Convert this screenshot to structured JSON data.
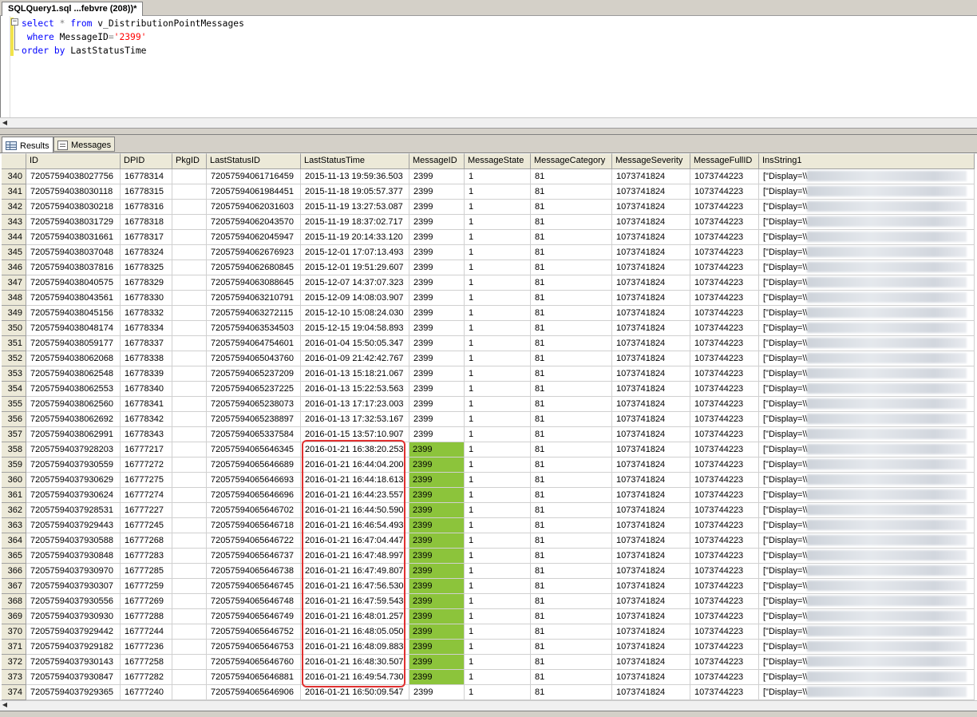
{
  "doc_tab": {
    "label": "SQLQuery1.sql ...febvre (208))*"
  },
  "query": {
    "line1": {
      "kw_select": "select",
      "star": " * ",
      "kw_from": "from",
      "table": " v_DistributionPointMessages"
    },
    "line2": {
      "kw_where": "where",
      "col": " MessageID",
      "op": "=",
      "value": "'2399'"
    },
    "line3": {
      "kw_order": "order",
      "kw_by": " by",
      "col": " LastStatusTime"
    }
  },
  "result_tabs": {
    "results": "Results",
    "messages": "Messages"
  },
  "columns": [
    "",
    "ID",
    "DPID",
    "PkgID",
    "LastStatusID",
    "LastStatusTime",
    "MessageID",
    "MessageState",
    "MessageCategory",
    "MessageSeverity",
    "MessageFullID",
    "InsString1"
  ],
  "rows": [
    [
      "340",
      "72057594038027756",
      "16778314",
      "",
      "72057594061716459",
      "2015-11-13 19:59:36.503",
      "2399",
      "1",
      "81",
      "1073741824",
      "1073744223",
      "[\"Display=\\\\"
    ],
    [
      "341",
      "72057594038030118",
      "16778315",
      "",
      "72057594061984451",
      "2015-11-18 19:05:57.377",
      "2399",
      "1",
      "81",
      "1073741824",
      "1073744223",
      "[\"Display=\\\\"
    ],
    [
      "342",
      "72057594038030218",
      "16778316",
      "",
      "72057594062031603",
      "2015-11-19 13:27:53.087",
      "2399",
      "1",
      "81",
      "1073741824",
      "1073744223",
      "[\"Display=\\\\"
    ],
    [
      "343",
      "72057594038031729",
      "16778318",
      "",
      "72057594062043570",
      "2015-11-19 18:37:02.717",
      "2399",
      "1",
      "81",
      "1073741824",
      "1073744223",
      "[\"Display=\\\\"
    ],
    [
      "344",
      "72057594038031661",
      "16778317",
      "",
      "72057594062045947",
      "2015-11-19 20:14:33.120",
      "2399",
      "1",
      "81",
      "1073741824",
      "1073744223",
      "[\"Display=\\\\"
    ],
    [
      "345",
      "72057594038037048",
      "16778324",
      "",
      "72057594062676923",
      "2015-12-01 17:07:13.493",
      "2399",
      "1",
      "81",
      "1073741824",
      "1073744223",
      "[\"Display=\\\\"
    ],
    [
      "346",
      "72057594038037816",
      "16778325",
      "",
      "72057594062680845",
      "2015-12-01 19:51:29.607",
      "2399",
      "1",
      "81",
      "1073741824",
      "1073744223",
      "[\"Display=\\\\"
    ],
    [
      "347",
      "72057594038040575",
      "16778329",
      "",
      "72057594063088645",
      "2015-12-07 14:37:07.323",
      "2399",
      "1",
      "81",
      "1073741824",
      "1073744223",
      "[\"Display=\\\\"
    ],
    [
      "348",
      "72057594038043561",
      "16778330",
      "",
      "72057594063210791",
      "2015-12-09 14:08:03.907",
      "2399",
      "1",
      "81",
      "1073741824",
      "1073744223",
      "[\"Display=\\\\"
    ],
    [
      "349",
      "72057594038045156",
      "16778332",
      "",
      "72057594063272115",
      "2015-12-10 15:08:24.030",
      "2399",
      "1",
      "81",
      "1073741824",
      "1073744223",
      "[\"Display=\\\\"
    ],
    [
      "350",
      "72057594038048174",
      "16778334",
      "",
      "72057594063534503",
      "2015-12-15 19:04:58.893",
      "2399",
      "1",
      "81",
      "1073741824",
      "1073744223",
      "[\"Display=\\\\"
    ],
    [
      "351",
      "72057594038059177",
      "16778337",
      "",
      "72057594064754601",
      "2016-01-04 15:50:05.347",
      "2399",
      "1",
      "81",
      "1073741824",
      "1073744223",
      "[\"Display=\\\\"
    ],
    [
      "352",
      "72057594038062068",
      "16778338",
      "",
      "72057594065043760",
      "2016-01-09 21:42:42.767",
      "2399",
      "1",
      "81",
      "1073741824",
      "1073744223",
      "[\"Display=\\\\"
    ],
    [
      "353",
      "72057594038062548",
      "16778339",
      "",
      "72057594065237209",
      "2016-01-13 15:18:21.067",
      "2399",
      "1",
      "81",
      "1073741824",
      "1073744223",
      "[\"Display=\\\\"
    ],
    [
      "354",
      "72057594038062553",
      "16778340",
      "",
      "72057594065237225",
      "2016-01-13 15:22:53.563",
      "2399",
      "1",
      "81",
      "1073741824",
      "1073744223",
      "[\"Display=\\\\"
    ],
    [
      "355",
      "72057594038062560",
      "16778341",
      "",
      "72057594065238073",
      "2016-01-13 17:17:23.003",
      "2399",
      "1",
      "81",
      "1073741824",
      "1073744223",
      "[\"Display=\\\\"
    ],
    [
      "356",
      "72057594038062692",
      "16778342",
      "",
      "72057594065238897",
      "2016-01-13 17:32:53.167",
      "2399",
      "1",
      "81",
      "1073741824",
      "1073744223",
      "[\"Display=\\\\"
    ],
    [
      "357",
      "72057594038062991",
      "16778343",
      "",
      "72057594065337584",
      "2016-01-15 13:57:10.907",
      "2399",
      "1",
      "81",
      "1073741824",
      "1073744223",
      "[\"Display=\\\\"
    ],
    [
      "358",
      "72057594037928203",
      "16777217",
      "",
      "72057594065646345",
      "2016-01-21 16:38:20.253",
      "2399",
      "1",
      "81",
      "1073741824",
      "1073744223",
      "[\"Display=\\\\"
    ],
    [
      "359",
      "72057594037930559",
      "16777272",
      "",
      "72057594065646689",
      "2016-01-21 16:44:04.200",
      "2399",
      "1",
      "81",
      "1073741824",
      "1073744223",
      "[\"Display=\\\\"
    ],
    [
      "360",
      "72057594037930629",
      "16777275",
      "",
      "72057594065646693",
      "2016-01-21 16:44:18.613",
      "2399",
      "1",
      "81",
      "1073741824",
      "1073744223",
      "[\"Display=\\\\"
    ],
    [
      "361",
      "72057594037930624",
      "16777274",
      "",
      "72057594065646696",
      "2016-01-21 16:44:23.557",
      "2399",
      "1",
      "81",
      "1073741824",
      "1073744223",
      "[\"Display=\\\\"
    ],
    [
      "362",
      "72057594037928531",
      "16777227",
      "",
      "72057594065646702",
      "2016-01-21 16:44:50.590",
      "2399",
      "1",
      "81",
      "1073741824",
      "1073744223",
      "[\"Display=\\\\"
    ],
    [
      "363",
      "72057594037929443",
      "16777245",
      "",
      "72057594065646718",
      "2016-01-21 16:46:54.493",
      "2399",
      "1",
      "81",
      "1073741824",
      "1073744223",
      "[\"Display=\\\\"
    ],
    [
      "364",
      "72057594037930588",
      "16777268",
      "",
      "72057594065646722",
      "2016-01-21 16:47:04.447",
      "2399",
      "1",
      "81",
      "1073741824",
      "1073744223",
      "[\"Display=\\\\"
    ],
    [
      "365",
      "72057594037930848",
      "16777283",
      "",
      "72057594065646737",
      "2016-01-21 16:47:48.997",
      "2399",
      "1",
      "81",
      "1073741824",
      "1073744223",
      "[\"Display=\\\\"
    ],
    [
      "366",
      "72057594037930970",
      "16777285",
      "",
      "72057594065646738",
      "2016-01-21 16:47:49.807",
      "2399",
      "1",
      "81",
      "1073741824",
      "1073744223",
      "[\"Display=\\\\"
    ],
    [
      "367",
      "72057594037930307",
      "16777259",
      "",
      "72057594065646745",
      "2016-01-21 16:47:56.530",
      "2399",
      "1",
      "81",
      "1073741824",
      "1073744223",
      "[\"Display=\\\\"
    ],
    [
      "368",
      "72057594037930556",
      "16777269",
      "",
      "72057594065646748",
      "2016-01-21 16:47:59.543",
      "2399",
      "1",
      "81",
      "1073741824",
      "1073744223",
      "[\"Display=\\\\"
    ],
    [
      "369",
      "72057594037930930",
      "16777288",
      "",
      "72057594065646749",
      "2016-01-21 16:48:01.257",
      "2399",
      "1",
      "81",
      "1073741824",
      "1073744223",
      "[\"Display=\\\\"
    ],
    [
      "370",
      "72057594037929442",
      "16777244",
      "",
      "72057594065646752",
      "2016-01-21 16:48:05.050",
      "2399",
      "1",
      "81",
      "1073741824",
      "1073744223",
      "[\"Display=\\\\"
    ],
    [
      "371",
      "72057594037929182",
      "16777236",
      "",
      "72057594065646753",
      "2016-01-21 16:48:09.883",
      "2399",
      "1",
      "81",
      "1073741824",
      "1073744223",
      "[\"Display=\\\\"
    ],
    [
      "372",
      "72057594037930143",
      "16777258",
      "",
      "72057594065646760",
      "2016-01-21 16:48:30.507",
      "2399",
      "1",
      "81",
      "1073741824",
      "1073744223",
      "[\"Display=\\\\"
    ],
    [
      "373",
      "72057594037930847",
      "16777282",
      "",
      "72057594065646881",
      "2016-01-21 16:49:54.730",
      "2399",
      "1",
      "81",
      "1073741824",
      "1073744223",
      "[\"Display=\\\\"
    ],
    [
      "374",
      "72057594037929365",
      "16777240",
      "",
      "72057594065646906",
      "2016-01-21 16:50:09.547",
      "2399",
      "1",
      "81",
      "1073741824",
      "1073744223",
      "[\"Display=\\\\"
    ]
  ],
  "highlighted_rows": [
    "358",
    "359",
    "360",
    "361",
    "362",
    "363",
    "364",
    "365",
    "366",
    "367",
    "368",
    "369",
    "370",
    "371",
    "372",
    "373"
  ],
  "colors": {
    "highlight": "#8cc43b",
    "annotation_box": "#e03030",
    "keyword": "#0000ff",
    "string": "#ff0000"
  }
}
